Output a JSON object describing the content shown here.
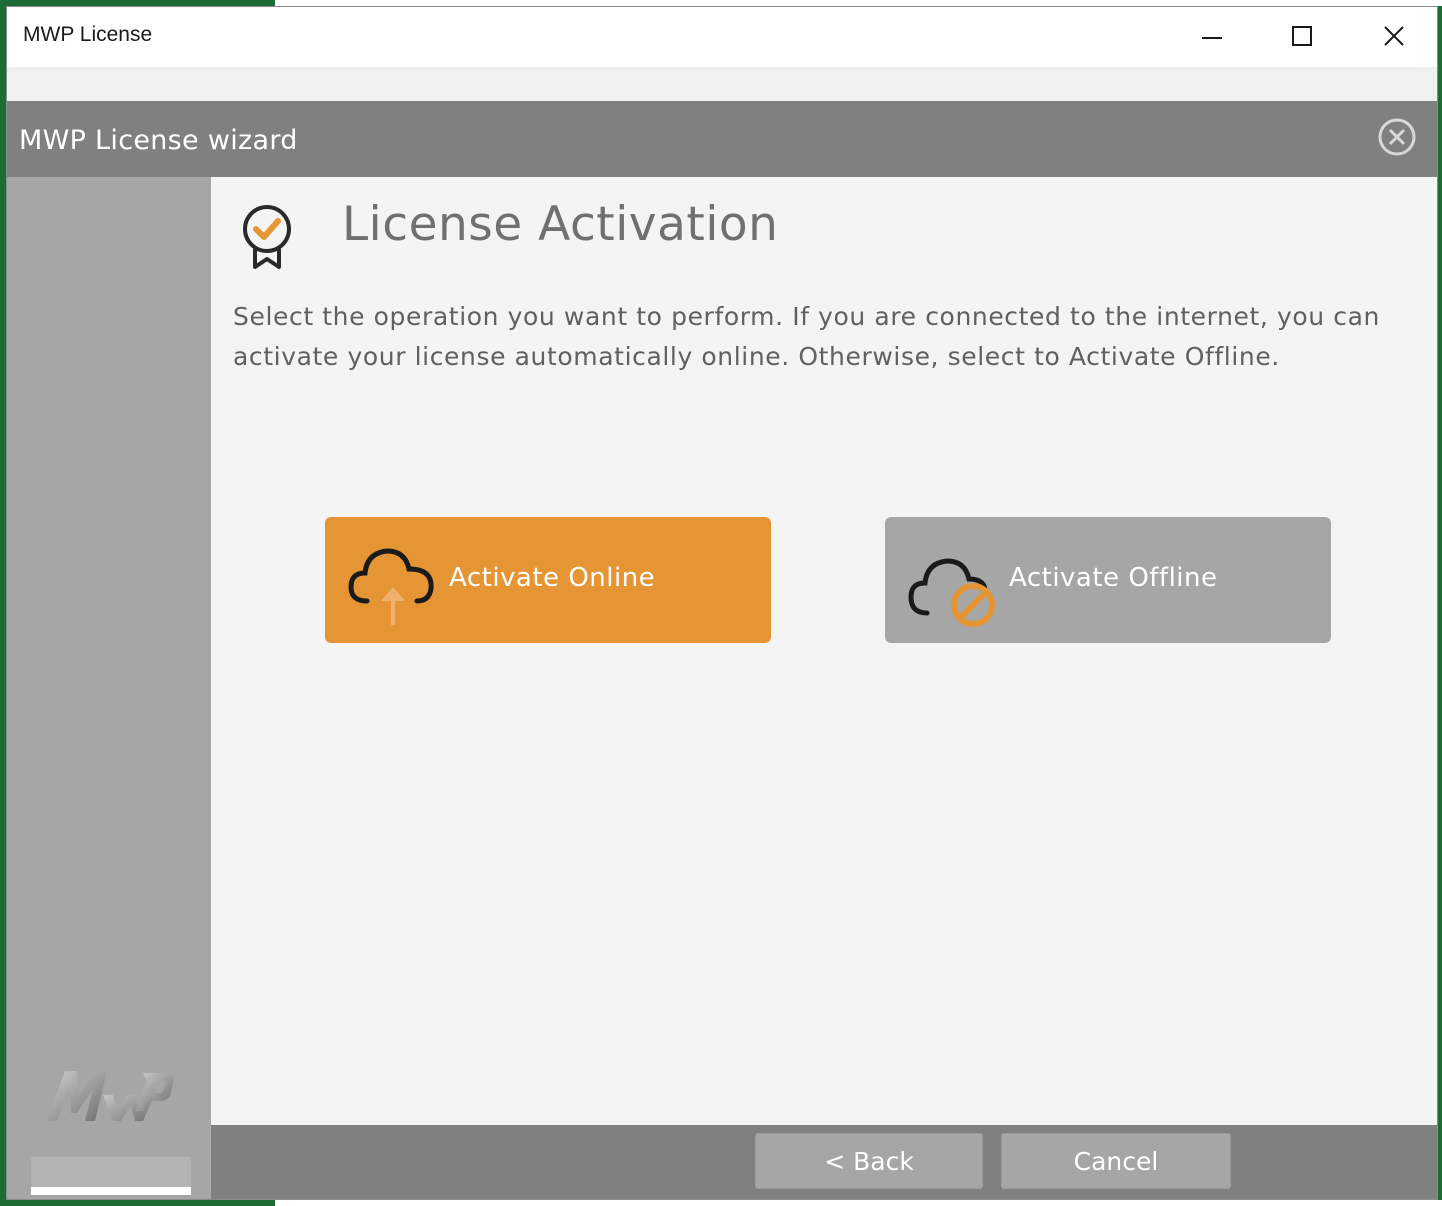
{
  "window": {
    "title": "MWP License"
  },
  "wizard": {
    "title": "MWP License wizard"
  },
  "page": {
    "title": "License Activation",
    "description": "Select the operation you want to perform. If you are connected to the internet, you can activate your license automatically online. Otherwise, select to Activate Offline."
  },
  "actions": {
    "online_label": "Activate Online",
    "offline_label": "Activate Offline"
  },
  "footer": {
    "back_label": "< Back",
    "cancel_label": "Cancel"
  },
  "colors": {
    "accent": "#e69535",
    "header_gray": "#808080",
    "sidebar_gray": "#a6a6a6"
  },
  "icons": {
    "minimize": "minimize-icon",
    "maximize": "maximize-icon",
    "close": "close-icon",
    "wizard_close": "circle-x-icon",
    "license": "certificate-badge-icon",
    "online": "cloud-upload-icon",
    "offline": "cloud-blocked-icon",
    "logo": "mwp-logo"
  }
}
